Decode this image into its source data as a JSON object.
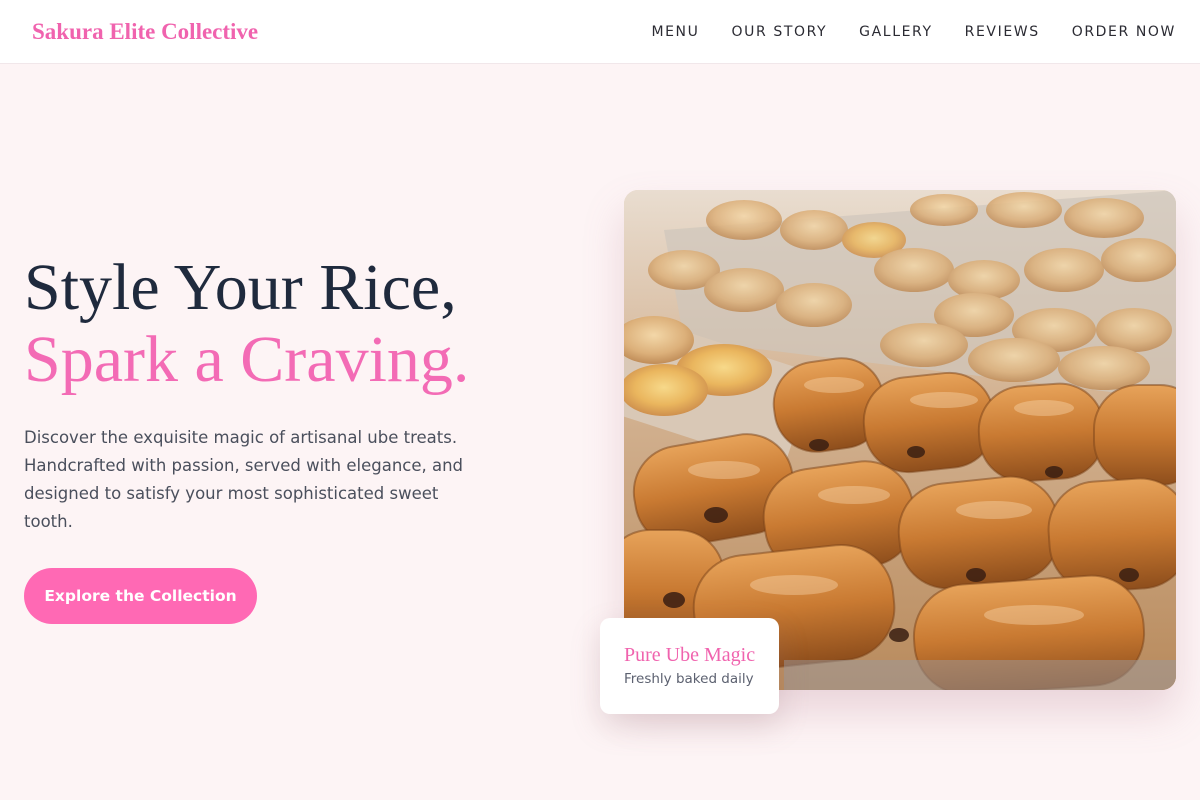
{
  "header": {
    "brand": "Sakura Elite Collective",
    "nav": [
      "MENU",
      "OUR STORY",
      "GALLERY",
      "REVIEWS",
      "ORDER NOW"
    ]
  },
  "hero": {
    "title_line1": "Style Your Rice,",
    "title_line2": "Spark a Craving.",
    "description": "Discover the exquisite magic of artisanal ube treats. Handcrafted with passion, served with elegance, and designed to satisfy your most sophisticated sweet tooth.",
    "cta_label": "Explore the Collection"
  },
  "feature": {
    "image_alt": "Pastries on baking trays",
    "caption_title": "Pure Ube Magic",
    "caption_subtitle": "Freshly baked daily"
  },
  "colors": {
    "accent": "#ff69b4",
    "brand_pink": "#f063ae",
    "heading": "#1f2a3d",
    "background": "#fdf4f5"
  }
}
